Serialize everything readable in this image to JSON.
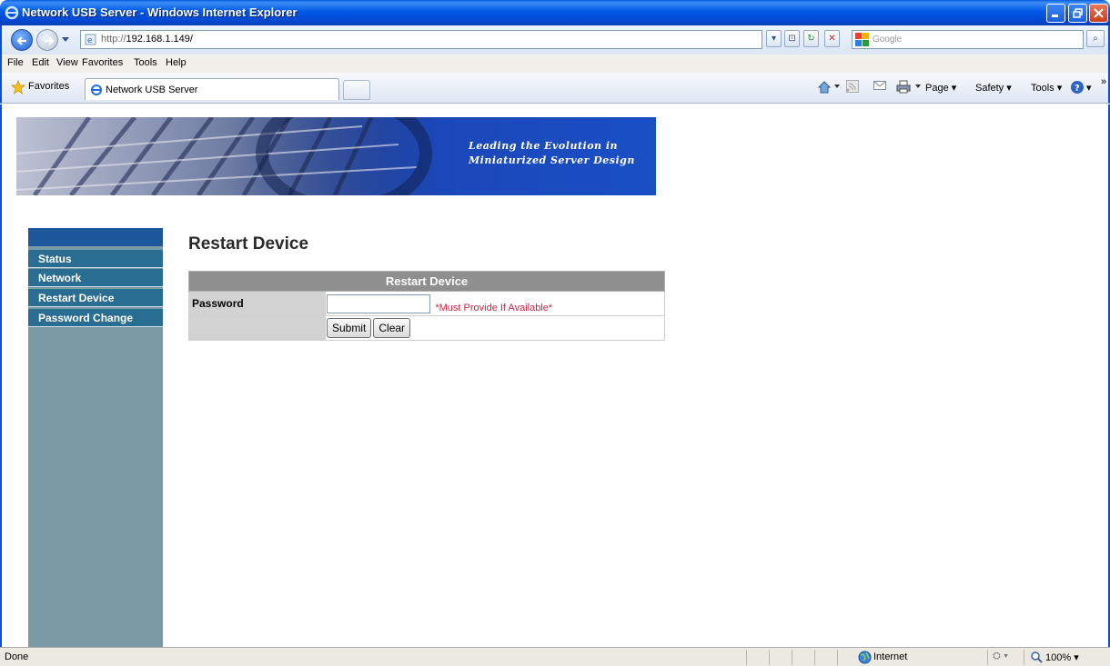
{
  "window": {
    "title": "Network USB Server - Windows Internet Explorer"
  },
  "addressbar": {
    "url_prefix": "http://",
    "url_host": "192.168.1.149/",
    "search_placeholder": "Google"
  },
  "menu": {
    "file": "File",
    "edit": "Edit",
    "view": "View",
    "favorites": "Favorites",
    "tools": "Tools",
    "help": "Help"
  },
  "favbar": {
    "favorites_label": "Favorites",
    "tab_title": "Network USB Server",
    "page_label": "Page",
    "safety_label": "Safety",
    "tools_label": "Tools"
  },
  "banner": {
    "slogan_line1": "Leading the Evolution in",
    "slogan_line2": "Miniaturized Server Design"
  },
  "sidebar": {
    "items": [
      {
        "label": "Status"
      },
      {
        "label": "Network"
      },
      {
        "label": "Restart Device"
      },
      {
        "label": "Password Change"
      }
    ]
  },
  "main": {
    "heading": "Restart Device",
    "table_header": "Restart Device",
    "password_label": "Password",
    "password_value": "",
    "hint": "*Must Provide If Available*",
    "submit_label": "Submit",
    "clear_label": "Clear"
  },
  "statusbar": {
    "status": "Done",
    "zone": "Internet",
    "zoom": "100%"
  },
  "colors": {
    "sidebar_bg": "#7a9aa5",
    "sidebar_item": "#2a6d92",
    "table_header": "#8f8f8f",
    "hint": "#cc2244"
  }
}
